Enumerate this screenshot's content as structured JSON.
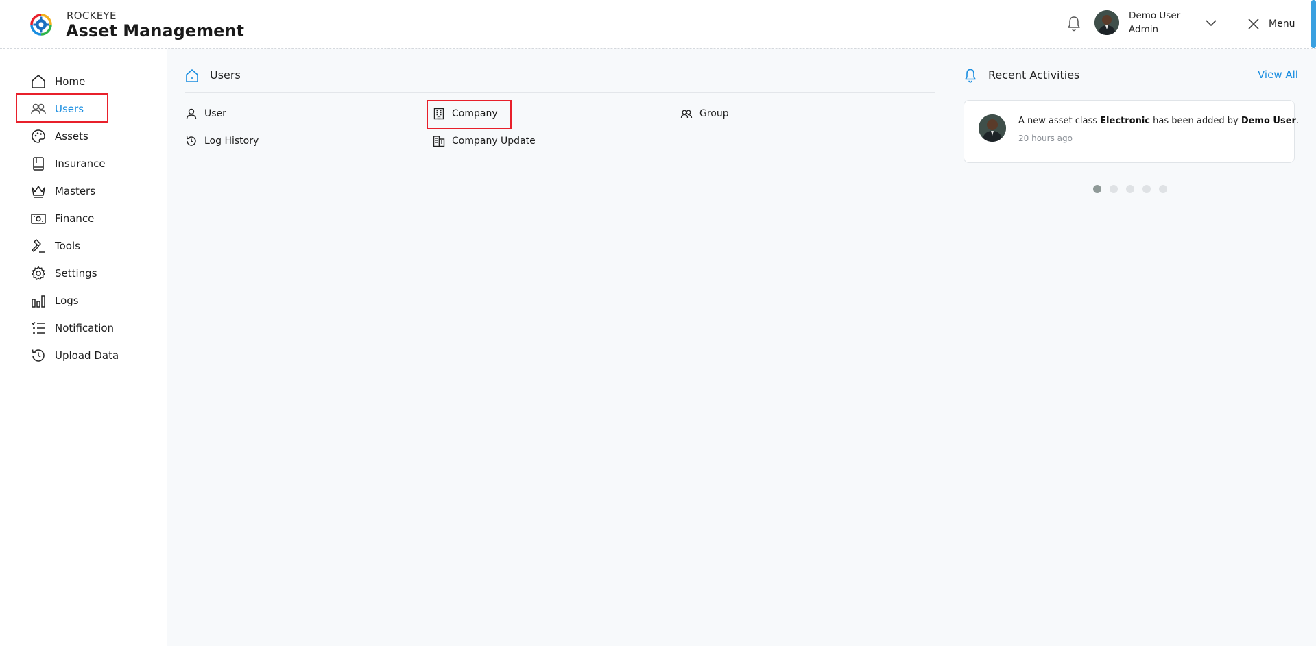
{
  "app": {
    "brand_small": "ROCKEYE",
    "brand_name": "Asset Management"
  },
  "header": {
    "user_name": "Demo User",
    "user_role": "Admin",
    "menu_label": "Menu"
  },
  "sidebar": {
    "items": [
      {
        "label": "Home",
        "icon": "home-icon"
      },
      {
        "label": "Users",
        "icon": "users-icon",
        "active": true
      },
      {
        "label": "Assets",
        "icon": "palette-icon"
      },
      {
        "label": "Insurance",
        "icon": "book-icon"
      },
      {
        "label": "Masters",
        "icon": "crown-icon"
      },
      {
        "label": "Finance",
        "icon": "money-icon"
      },
      {
        "label": "Tools",
        "icon": "gavel-icon"
      },
      {
        "label": "Settings",
        "icon": "gear-icon"
      },
      {
        "label": "Logs",
        "icon": "bar-chart-icon"
      },
      {
        "label": "Notification",
        "icon": "checklist-icon"
      },
      {
        "label": "Upload Data",
        "icon": "history-icon"
      }
    ]
  },
  "main": {
    "section_title": "Users",
    "sub_items": [
      {
        "label": "User",
        "icon": "user-icon"
      },
      {
        "label": "Company",
        "icon": "building-icon"
      },
      {
        "label": "Group",
        "icon": "group-icon"
      },
      {
        "label": "Log History",
        "icon": "history-icon"
      },
      {
        "label": "Company Update",
        "icon": "buildings-icon"
      }
    ]
  },
  "recent_activities": {
    "title": "Recent Activities",
    "view_all": "View All",
    "activity": {
      "text_1": "A new asset class ",
      "asset_class": "Electronic",
      "text_2": " has been added by ",
      "actor": "Demo User",
      "text_3": ".",
      "time": "20 hours ago"
    },
    "carousel_pages": 5,
    "carousel_active": 1
  },
  "colors": {
    "accent": "#1b8ee0",
    "highlight": "#e8202b",
    "main_bg": "#f7f9fb"
  }
}
